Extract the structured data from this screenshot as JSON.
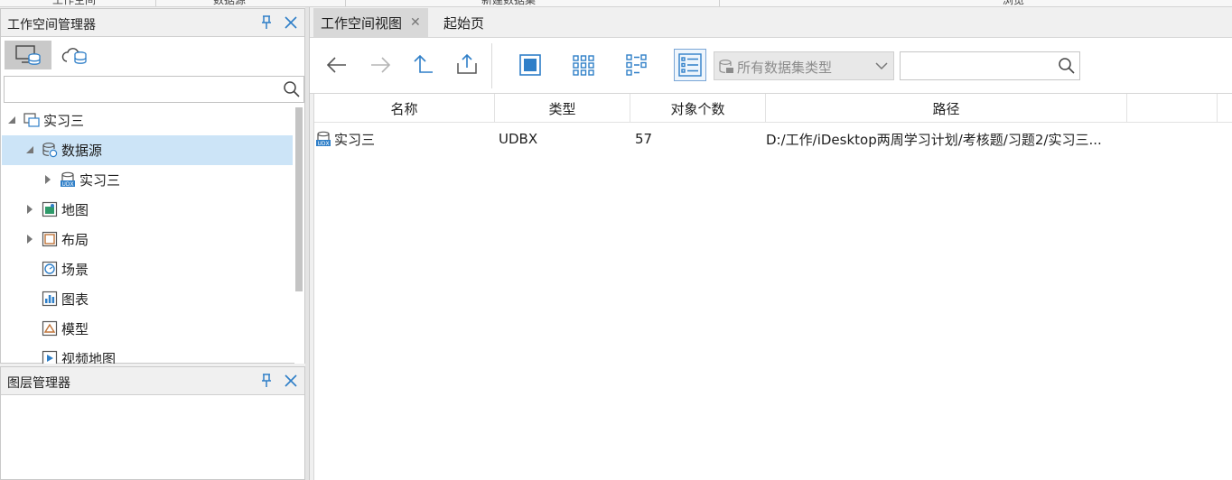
{
  "ribbon": {
    "items": [
      "工作空间",
      "数据源",
      "新建数据集",
      "浏览"
    ]
  },
  "workspace_manager": {
    "title": "工作空间管理器",
    "search_value": "",
    "tree": [
      {
        "label": "实习三",
        "icon": "workspace-icon",
        "level": 0,
        "expanded": true
      },
      {
        "label": "数据源",
        "icon": "datasource-icon",
        "level": 1,
        "expanded": true,
        "selected": true
      },
      {
        "label": "实习三",
        "icon": "udbx-datasource-icon",
        "level": 2,
        "expanded": false
      },
      {
        "label": "地图",
        "icon": "map-icon",
        "level": 1,
        "expanded": false
      },
      {
        "label": "布局",
        "icon": "layout-icon",
        "level": 1,
        "expanded": false
      },
      {
        "label": "场景",
        "icon": "scene-icon",
        "level": 1
      },
      {
        "label": "图表",
        "icon": "chart-icon",
        "level": 1
      },
      {
        "label": "模型",
        "icon": "model-icon",
        "level": 1
      },
      {
        "label": "视频地图",
        "icon": "video-map-icon",
        "level": 1
      }
    ]
  },
  "layer_manager": {
    "title": "图层管理器"
  },
  "tabs": [
    {
      "label": "工作空间视图",
      "active": true
    },
    {
      "label": "起始页",
      "active": false
    }
  ],
  "toolbar": {
    "dataset_type_selected": "所有数据集类型",
    "search_value": ""
  },
  "table": {
    "columns": [
      "名称",
      "类型",
      "对象个数",
      "路径"
    ],
    "rows": [
      {
        "name": "实习三",
        "type": "UDBX",
        "count": "57",
        "path": "D:/工作/iDesktop两周学习计划/考核题/习题2/实习三..."
      }
    ]
  },
  "colors": {
    "selected_row": "#cce4f7",
    "accent_blue": "#2f7fc8"
  }
}
